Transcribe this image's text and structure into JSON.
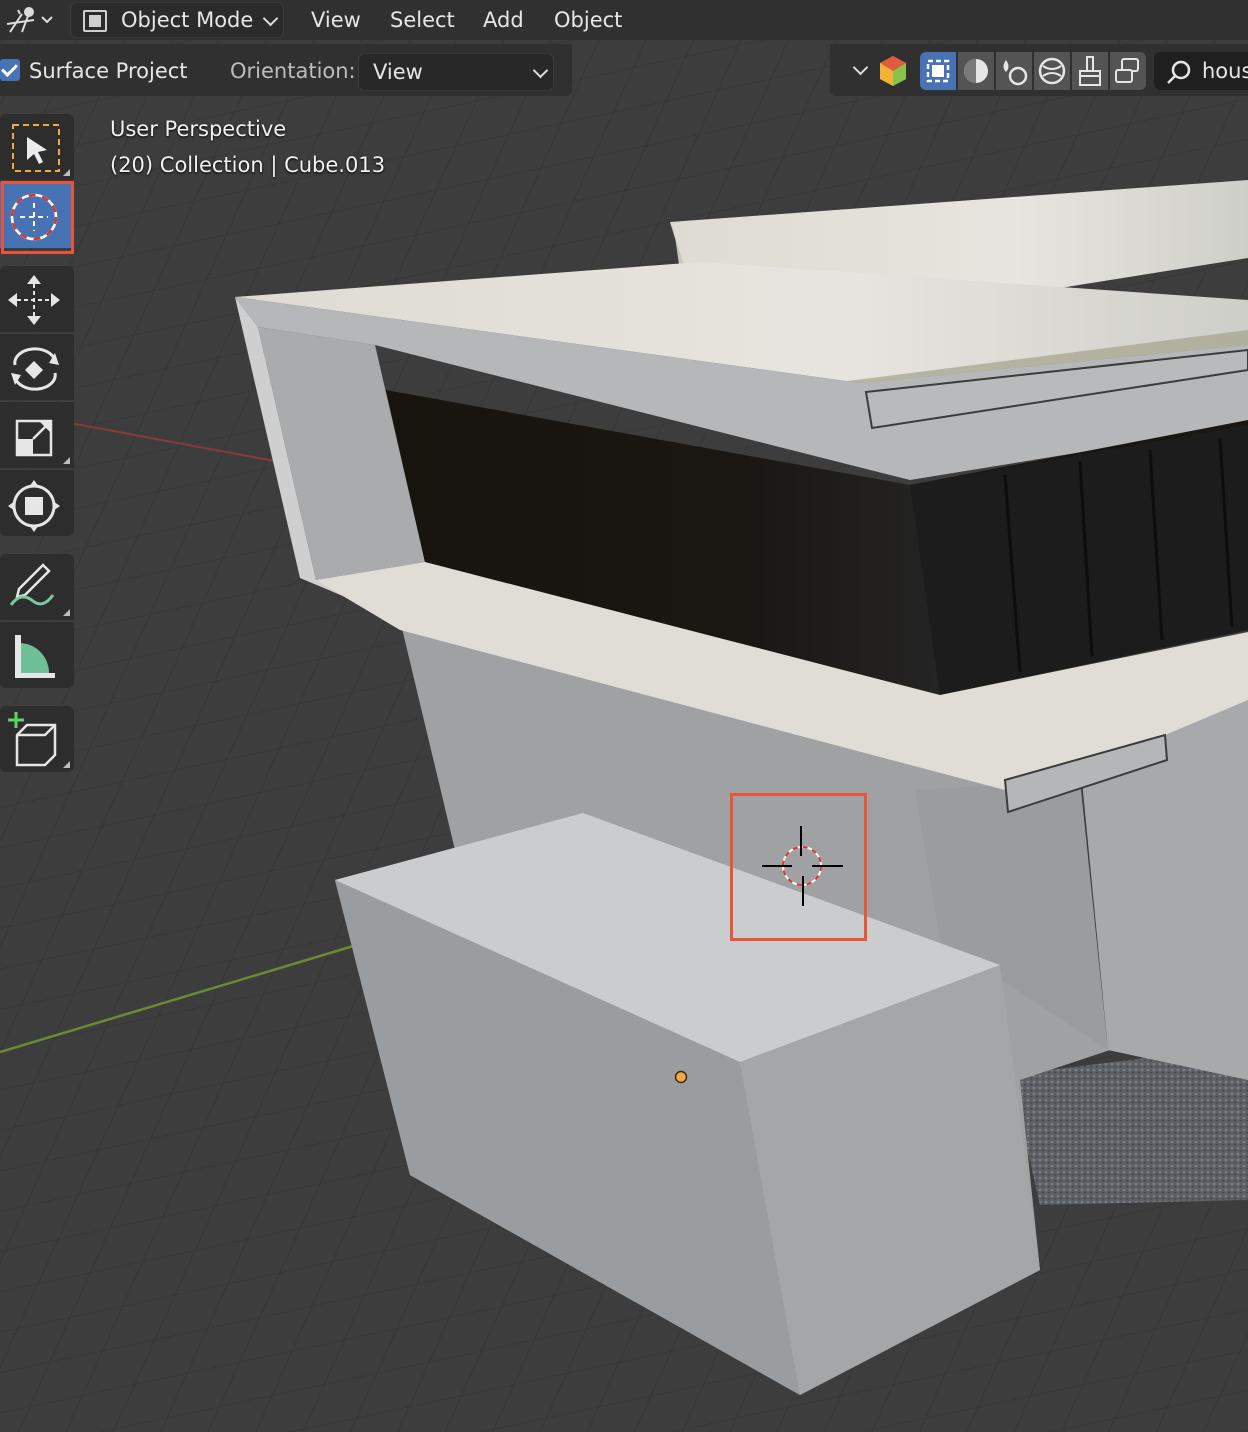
{
  "header": {
    "editor_type_icon": "editor-type-icon",
    "mode": "Object Mode",
    "menus": [
      "View",
      "Select",
      "Add",
      "Object"
    ]
  },
  "tool_settings": {
    "surface_project_label": "Surface Project",
    "surface_project_checked": true,
    "orientation_label": "Orientation:",
    "orientation_value": "View",
    "search_value": "hous"
  },
  "viewport": {
    "view_name": "User Perspective",
    "collection_info": "(20) Collection | Cube.013"
  },
  "tools": [
    {
      "name": "select-box-tool",
      "icon": "select-box-icon",
      "active": false
    },
    {
      "name": "cursor-tool",
      "icon": "cursor-icon",
      "active": true
    },
    {
      "name": "move-tool",
      "icon": "move-icon",
      "active": false
    },
    {
      "name": "rotate-tool",
      "icon": "rotate-icon",
      "active": false
    },
    {
      "name": "scale-tool",
      "icon": "scale-icon",
      "active": false
    },
    {
      "name": "transform-tool",
      "icon": "transform-icon",
      "active": false
    },
    {
      "name": "annotate-tool",
      "icon": "annotate-icon",
      "active": false
    },
    {
      "name": "measure-tool",
      "icon": "measure-icon",
      "active": false
    },
    {
      "name": "add-cube-tool",
      "icon": "add-cube-icon",
      "active": false
    }
  ],
  "colors": {
    "accent": "#4772b3",
    "highlight": "#e8553a",
    "header_bg": "#303030",
    "viewport_bg": "#3d3d3d"
  }
}
